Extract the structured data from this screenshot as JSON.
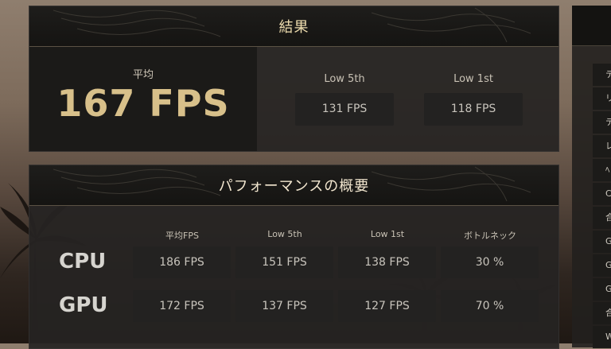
{
  "results": {
    "title": "結果",
    "average_label": "平均",
    "average_value": "167 FPS",
    "low5_label": "Low 5th",
    "low5_value": "131 FPS",
    "low1_label": "Low 1st",
    "low1_value": "118 FPS"
  },
  "performance": {
    "title": "パフォーマンスの概要",
    "columns": [
      "平均FPS",
      "Low 5th",
      "Low 1st",
      "ボトルネック"
    ],
    "rows": [
      {
        "label": "CPU",
        "values": [
          "186 FPS",
          "151 FPS",
          "138 FPS",
          "30 %"
        ]
      },
      {
        "label": "GPU",
        "values": [
          "172 FPS",
          "137 FPS",
          "127 FPS",
          "70 %"
        ]
      }
    ]
  },
  "side_panel": {
    "items": [
      "テ",
      "リ",
      "テ",
      "レ",
      "ﾍ",
      "C",
      "合",
      "G",
      "G",
      "G",
      "合",
      "W"
    ]
  },
  "colors": {
    "accent_gold": "#d8c08a",
    "panel_bg": "#262422",
    "value_box": "#232221"
  }
}
